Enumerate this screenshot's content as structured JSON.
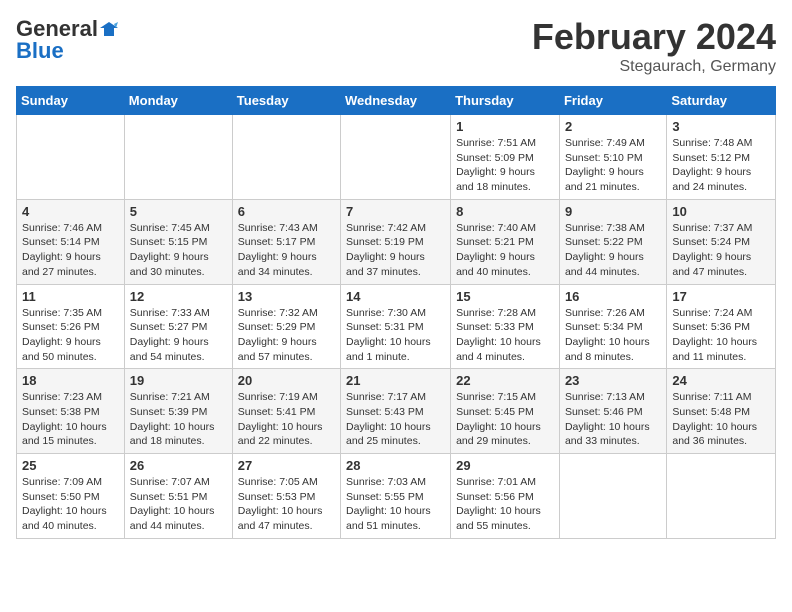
{
  "header": {
    "logo_line1": "General",
    "logo_line2": "Blue",
    "month": "February 2024",
    "location": "Stegaurach, Germany"
  },
  "days_of_week": [
    "Sunday",
    "Monday",
    "Tuesday",
    "Wednesday",
    "Thursday",
    "Friday",
    "Saturday"
  ],
  "weeks": [
    [
      {
        "day": "",
        "detail": ""
      },
      {
        "day": "",
        "detail": ""
      },
      {
        "day": "",
        "detail": ""
      },
      {
        "day": "",
        "detail": ""
      },
      {
        "day": "1",
        "detail": "Sunrise: 7:51 AM\nSunset: 5:09 PM\nDaylight: 9 hours\nand 18 minutes."
      },
      {
        "day": "2",
        "detail": "Sunrise: 7:49 AM\nSunset: 5:10 PM\nDaylight: 9 hours\nand 21 minutes."
      },
      {
        "day": "3",
        "detail": "Sunrise: 7:48 AM\nSunset: 5:12 PM\nDaylight: 9 hours\nand 24 minutes."
      }
    ],
    [
      {
        "day": "4",
        "detail": "Sunrise: 7:46 AM\nSunset: 5:14 PM\nDaylight: 9 hours\nand 27 minutes."
      },
      {
        "day": "5",
        "detail": "Sunrise: 7:45 AM\nSunset: 5:15 PM\nDaylight: 9 hours\nand 30 minutes."
      },
      {
        "day": "6",
        "detail": "Sunrise: 7:43 AM\nSunset: 5:17 PM\nDaylight: 9 hours\nand 34 minutes."
      },
      {
        "day": "7",
        "detail": "Sunrise: 7:42 AM\nSunset: 5:19 PM\nDaylight: 9 hours\nand 37 minutes."
      },
      {
        "day": "8",
        "detail": "Sunrise: 7:40 AM\nSunset: 5:21 PM\nDaylight: 9 hours\nand 40 minutes."
      },
      {
        "day": "9",
        "detail": "Sunrise: 7:38 AM\nSunset: 5:22 PM\nDaylight: 9 hours\nand 44 minutes."
      },
      {
        "day": "10",
        "detail": "Sunrise: 7:37 AM\nSunset: 5:24 PM\nDaylight: 9 hours\nand 47 minutes."
      }
    ],
    [
      {
        "day": "11",
        "detail": "Sunrise: 7:35 AM\nSunset: 5:26 PM\nDaylight: 9 hours\nand 50 minutes."
      },
      {
        "day": "12",
        "detail": "Sunrise: 7:33 AM\nSunset: 5:27 PM\nDaylight: 9 hours\nand 54 minutes."
      },
      {
        "day": "13",
        "detail": "Sunrise: 7:32 AM\nSunset: 5:29 PM\nDaylight: 9 hours\nand 57 minutes."
      },
      {
        "day": "14",
        "detail": "Sunrise: 7:30 AM\nSunset: 5:31 PM\nDaylight: 10 hours\nand 1 minute."
      },
      {
        "day": "15",
        "detail": "Sunrise: 7:28 AM\nSunset: 5:33 PM\nDaylight: 10 hours\nand 4 minutes."
      },
      {
        "day": "16",
        "detail": "Sunrise: 7:26 AM\nSunset: 5:34 PM\nDaylight: 10 hours\nand 8 minutes."
      },
      {
        "day": "17",
        "detail": "Sunrise: 7:24 AM\nSunset: 5:36 PM\nDaylight: 10 hours\nand 11 minutes."
      }
    ],
    [
      {
        "day": "18",
        "detail": "Sunrise: 7:23 AM\nSunset: 5:38 PM\nDaylight: 10 hours\nand 15 minutes."
      },
      {
        "day": "19",
        "detail": "Sunrise: 7:21 AM\nSunset: 5:39 PM\nDaylight: 10 hours\nand 18 minutes."
      },
      {
        "day": "20",
        "detail": "Sunrise: 7:19 AM\nSunset: 5:41 PM\nDaylight: 10 hours\nand 22 minutes."
      },
      {
        "day": "21",
        "detail": "Sunrise: 7:17 AM\nSunset: 5:43 PM\nDaylight: 10 hours\nand 25 minutes."
      },
      {
        "day": "22",
        "detail": "Sunrise: 7:15 AM\nSunset: 5:45 PM\nDaylight: 10 hours\nand 29 minutes."
      },
      {
        "day": "23",
        "detail": "Sunrise: 7:13 AM\nSunset: 5:46 PM\nDaylight: 10 hours\nand 33 minutes."
      },
      {
        "day": "24",
        "detail": "Sunrise: 7:11 AM\nSunset: 5:48 PM\nDaylight: 10 hours\nand 36 minutes."
      }
    ],
    [
      {
        "day": "25",
        "detail": "Sunrise: 7:09 AM\nSunset: 5:50 PM\nDaylight: 10 hours\nand 40 minutes."
      },
      {
        "day": "26",
        "detail": "Sunrise: 7:07 AM\nSunset: 5:51 PM\nDaylight: 10 hours\nand 44 minutes."
      },
      {
        "day": "27",
        "detail": "Sunrise: 7:05 AM\nSunset: 5:53 PM\nDaylight: 10 hours\nand 47 minutes."
      },
      {
        "day": "28",
        "detail": "Sunrise: 7:03 AM\nSunset: 5:55 PM\nDaylight: 10 hours\nand 51 minutes."
      },
      {
        "day": "29",
        "detail": "Sunrise: 7:01 AM\nSunset: 5:56 PM\nDaylight: 10 hours\nand 55 minutes."
      },
      {
        "day": "",
        "detail": ""
      },
      {
        "day": "",
        "detail": ""
      }
    ]
  ]
}
